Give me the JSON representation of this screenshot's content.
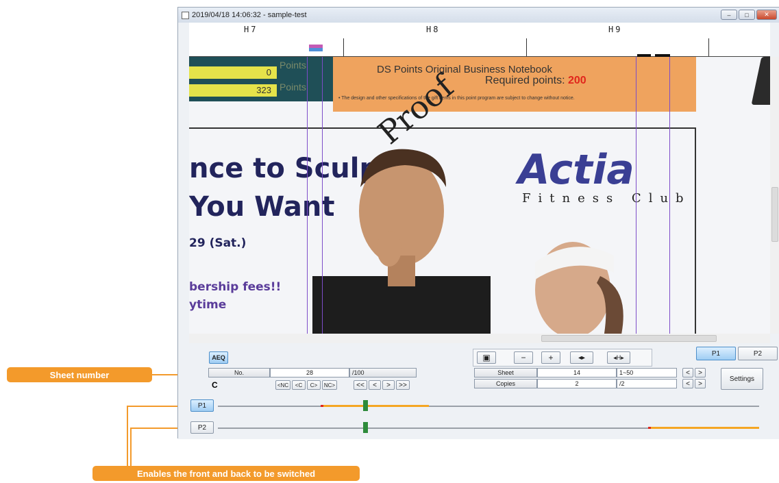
{
  "window": {
    "title": "2019/04/18 14:06:32 - sample-test",
    "minimize": "–",
    "maximize": "□",
    "close": "✕"
  },
  "ruler": {
    "labels": [
      "H7",
      "H8",
      "H9"
    ]
  },
  "document": {
    "points_value_1": "0",
    "points_value_2": "323",
    "points_label": "Points",
    "notebook_title": "DS Points Original Business Notebook",
    "required_points_label": "Required points: ",
    "required_points_value": "200",
    "notice": "• The design and other specifications of the gift items in this point program are subject to change without notice.",
    "proof": "Proof",
    "headline_1": "nce to Sculpt",
    "headline_2": "You Want",
    "date_line": "29 (Sat.)",
    "fees_line": "bership fees!!",
    "anytime_line": "ytime",
    "brand": "Actia",
    "brand_sub": "Fitness Club"
  },
  "controls": {
    "aeq_label": "AEQ",
    "no_label": "No.",
    "no_value": "28",
    "no_total": "/100",
    "refresh_icon": "C",
    "nav_nc_prev": "<NC",
    "nav_c_prev": "<C",
    "nav_c_next": "C>",
    "nav_nc_next": "NC>",
    "nav_first": "<<",
    "nav_prev": "<",
    "nav_next": ">",
    "nav_last": ">>",
    "zoom_fit": "▣",
    "zoom_out": "−",
    "zoom_in": "+",
    "fit_width": "◂▸",
    "fit_height": "◂H▸",
    "page_p1": "P1",
    "page_p2": "P2",
    "sheet_label": "Sheet",
    "sheet_value": "14",
    "sheet_range": "1~50",
    "copies_label": "Copies",
    "copies_value": "2",
    "copies_total": "/2",
    "step_prev": "<",
    "step_next": ">",
    "settings": "Settings",
    "track_p1": "P1",
    "track_p2": "P2"
  },
  "callouts": {
    "sheet_number": "Sheet number",
    "front_back": "Enables the front and back to be switched"
  },
  "colors": {
    "accent_orange": "#f39a2b",
    "guide_purple": "#7d4cc9",
    "marker_green": "#2e8b3b",
    "track_orange": "#f5a623"
  }
}
